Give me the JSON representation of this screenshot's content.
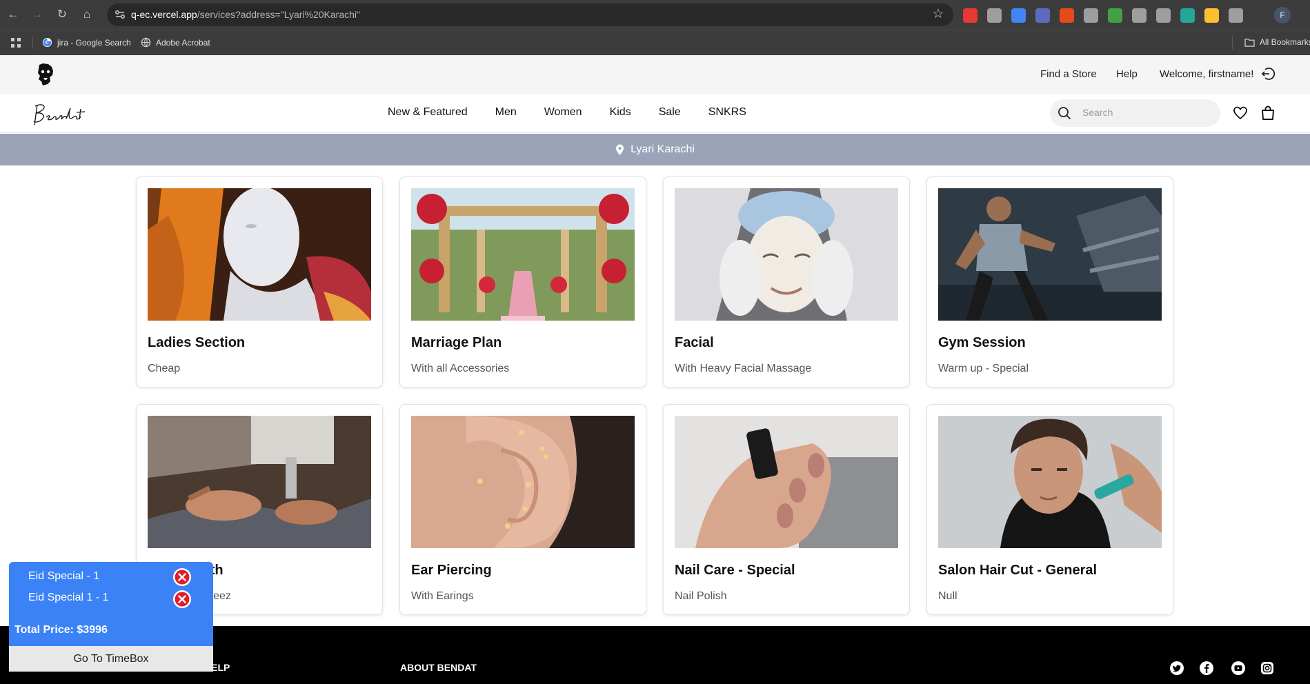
{
  "browser": {
    "url_host": "q-ec.vercel.app",
    "url_path": "/services?address=\"Lyari%20Karachi\"",
    "bookmarks": [
      {
        "label": "jira - Google Search"
      },
      {
        "label": "Adobe Acrobat"
      }
    ],
    "all_bookmarks": "All Bookmarks",
    "profile_initial": "F",
    "extension_colors": [
      "#e53935",
      "#9e9e9e",
      "#4285f4",
      "#5c6bc0",
      "#e64a19",
      "#9e9e9e",
      "#43a047",
      "#9e9e9e",
      "#9e9e9e",
      "#26a69a",
      "#fbc02d",
      "#9e9e9e"
    ]
  },
  "site": {
    "util_links": {
      "find_store": "Find a Store",
      "help": "Help",
      "welcome": "Welcome, firstname!"
    },
    "nav": [
      "New & Featured",
      "Men",
      "Women",
      "Kids",
      "Sale",
      "SNKRS"
    ],
    "search_placeholder": "Search",
    "location": "Lyari Karachi",
    "location_bar_color": "#9aa3b7"
  },
  "services": [
    {
      "title": "Ladies Section",
      "subtitle": "Cheap",
      "image": "mannequin"
    },
    {
      "title": "Marriage Plan",
      "subtitle": "With all Accessories",
      "image": "wedding-aisle"
    },
    {
      "title": "Facial",
      "subtitle": "With Heavy Facial Massage",
      "image": "facial"
    },
    {
      "title": "Gym Session",
      "subtitle": "Warm up - Special",
      "image": "treadmill"
    },
    {
      "title": "Tailor Cloth",
      "subtitle": "Shalwar Kameez",
      "image": "sewing"
    },
    {
      "title": "Ear Piercing",
      "subtitle": "With Earings",
      "image": "ear"
    },
    {
      "title": "Nail Care - Special",
      "subtitle": "Nail Polish",
      "image": "nails"
    },
    {
      "title": "Salon Hair Cut - General",
      "subtitle": "Null",
      "image": "haircut"
    }
  ],
  "footer": {
    "help_heading": "HELP",
    "about_heading": "ABOUT BENDAT",
    "social_icons": [
      "twitter-icon",
      "facebook-icon",
      "youtube-icon",
      "instagram-icon"
    ]
  },
  "cart": {
    "items": [
      "Eid Special - 1",
      "Eid Special 1 - 1"
    ],
    "total": "Total Price: $3996",
    "button": "Go To TimeBox",
    "color": "#3b82f6"
  }
}
